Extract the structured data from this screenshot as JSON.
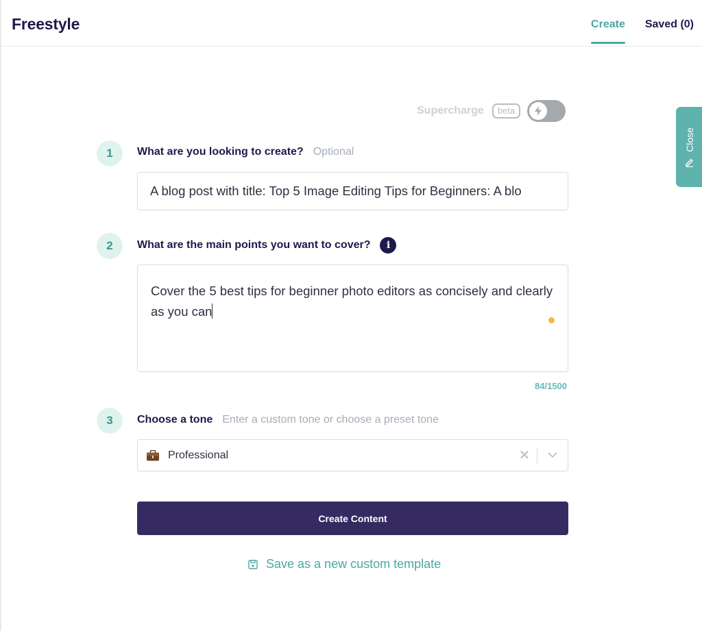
{
  "header": {
    "title": "Freestyle",
    "tabs": [
      {
        "label": "Create",
        "active": true
      },
      {
        "label": "Saved (0)",
        "active": false
      }
    ]
  },
  "supercharge": {
    "label": "Supercharge",
    "badge": "beta",
    "enabled": false,
    "toggle_icon": "lightning-icon"
  },
  "side_tab": {
    "label": "Close",
    "icon": "pencil-icon"
  },
  "steps": [
    {
      "number": "1",
      "label": "What are you looking to create?",
      "hint": "Optional",
      "value": "A blog post with title: Top 5 Image Editing Tips for Beginners: A blo"
    },
    {
      "number": "2",
      "label": "What are the main points you want to cover?",
      "info_icon": "i",
      "value": "Cover the 5 best tips for beginner photo editors as concisely and clearly as you can",
      "counter": "84/1500"
    },
    {
      "number": "3",
      "label": "Choose a tone",
      "hint": "Enter a custom tone or choose a preset tone",
      "selected": "Professional",
      "selected_icon": "briefcase-icon",
      "clear_glyph": "✕"
    }
  ],
  "actions": {
    "create_label": "Create Content",
    "save_template_label": "Save as a new custom template"
  },
  "colors": {
    "accent": "#4da6a0",
    "primary_button": "#352b62",
    "heading": "#1d1a4b",
    "status_dot": "#f3b940"
  }
}
